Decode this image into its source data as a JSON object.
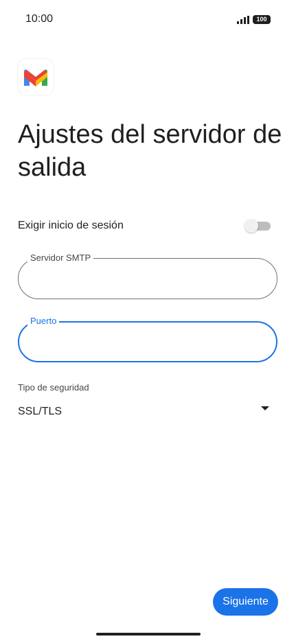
{
  "status_bar": {
    "time": "10:00",
    "signal_icon": "signal-bars-icon",
    "battery_level": "100"
  },
  "app": {
    "logo_icon": "gmail-logo-icon"
  },
  "header": {
    "title": "Ajustes del servidor de salida"
  },
  "form": {
    "require_login": {
      "label": "Exigir inicio de sesión",
      "enabled": false
    },
    "smtp_server": {
      "label": "Servidor SMTP",
      "value": ""
    },
    "port": {
      "label": "Puerto",
      "value": "",
      "focused": true
    },
    "security": {
      "caption": "Tipo de seguridad",
      "selected": "SSL/TLS"
    }
  },
  "actions": {
    "next_label": "Siguiente"
  },
  "colors": {
    "accent": "#1a73e8",
    "text": "#1f1f1f",
    "outline": "#6f6f6f"
  }
}
